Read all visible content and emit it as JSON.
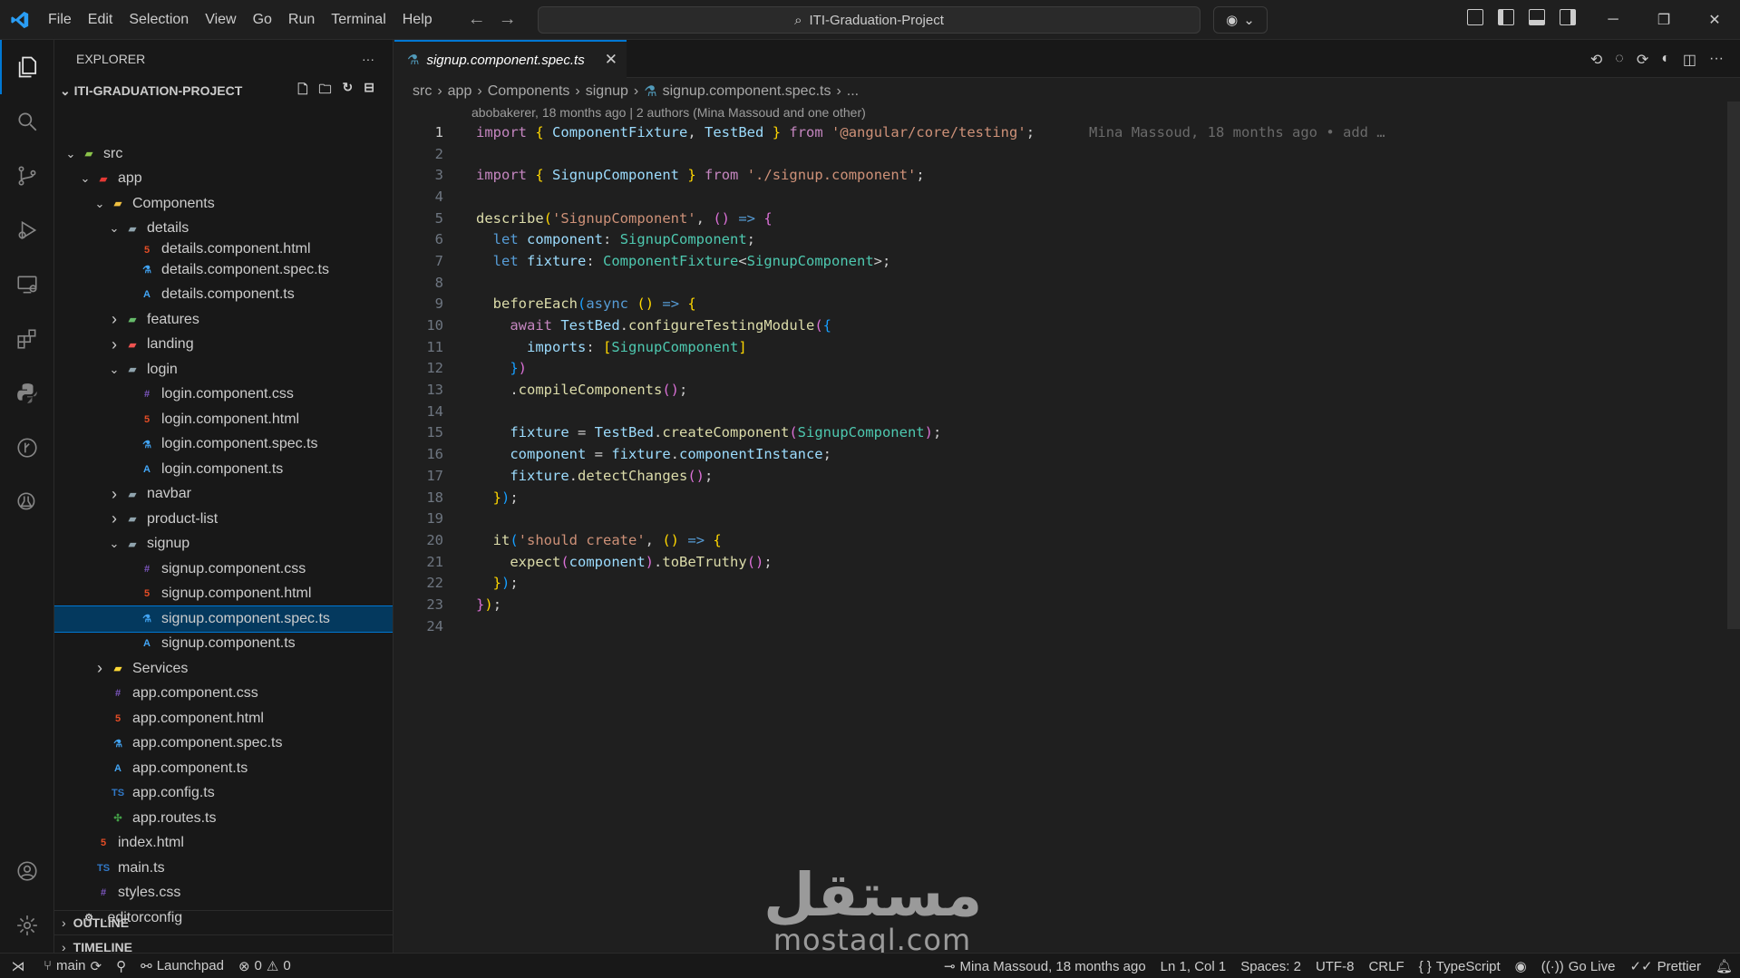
{
  "menu": [
    "File",
    "Edit",
    "Selection",
    "View",
    "Go",
    "Run",
    "Terminal",
    "Help"
  ],
  "command_center": "ITI-Graduation-Project",
  "sidebar": {
    "title": "EXPLORER",
    "project": "ITI-GRADUATION-PROJECT",
    "tree": [
      {
        "label": "src",
        "depth": 1,
        "kind": "folder-open",
        "icon": "src-folder-icon"
      },
      {
        "label": "app",
        "depth": 2,
        "kind": "folder-open",
        "icon": "app-folder-icon"
      },
      {
        "label": "Components",
        "depth": 3,
        "kind": "folder-open",
        "icon": "components-folder-icon"
      },
      {
        "label": "details",
        "depth": 4,
        "kind": "folder-open",
        "icon": "folder-icon"
      },
      {
        "label": "details.component.html",
        "depth": 5,
        "kind": "file",
        "icon": "html-icon"
      },
      {
        "label": "details.component.spec.ts",
        "depth": 5,
        "kind": "file",
        "icon": "test-icon"
      },
      {
        "label": "details.component.ts",
        "depth": 5,
        "kind": "file",
        "icon": "angular-icon"
      },
      {
        "label": "features",
        "depth": 4,
        "kind": "folder",
        "icon": "features-folder-icon"
      },
      {
        "label": "landing",
        "depth": 4,
        "kind": "folder",
        "icon": "landing-folder-icon"
      },
      {
        "label": "login",
        "depth": 4,
        "kind": "folder-open",
        "icon": "folder-icon"
      },
      {
        "label": "login.component.css",
        "depth": 5,
        "kind": "file",
        "icon": "css-icon"
      },
      {
        "label": "login.component.html",
        "depth": 5,
        "kind": "file",
        "icon": "html-icon"
      },
      {
        "label": "login.component.spec.ts",
        "depth": 5,
        "kind": "file",
        "icon": "test-icon"
      },
      {
        "label": "login.component.ts",
        "depth": 5,
        "kind": "file",
        "icon": "angular-icon"
      },
      {
        "label": "navbar",
        "depth": 4,
        "kind": "folder",
        "icon": "folder-icon"
      },
      {
        "label": "product-list",
        "depth": 4,
        "kind": "folder",
        "icon": "folder-icon"
      },
      {
        "label": "signup",
        "depth": 4,
        "kind": "folder-open",
        "icon": "folder-icon"
      },
      {
        "label": "signup.component.css",
        "depth": 5,
        "kind": "file",
        "icon": "css-icon"
      },
      {
        "label": "signup.component.html",
        "depth": 5,
        "kind": "file",
        "icon": "html-icon"
      },
      {
        "label": "signup.component.spec.ts",
        "depth": 5,
        "kind": "file",
        "icon": "test-icon",
        "selected": true
      },
      {
        "label": "signup.component.ts",
        "depth": 5,
        "kind": "file",
        "icon": "angular-icon"
      },
      {
        "label": "Services",
        "depth": 3,
        "kind": "folder",
        "icon": "services-folder-icon"
      },
      {
        "label": "app.component.css",
        "depth": 3,
        "kind": "file",
        "icon": "css-icon"
      },
      {
        "label": "app.component.html",
        "depth": 3,
        "kind": "file",
        "icon": "html-icon"
      },
      {
        "label": "app.component.spec.ts",
        "depth": 3,
        "kind": "file",
        "icon": "test-icon"
      },
      {
        "label": "app.component.ts",
        "depth": 3,
        "kind": "file",
        "icon": "angular-icon"
      },
      {
        "label": "app.config.ts",
        "depth": 3,
        "kind": "file",
        "icon": "ts-icon"
      },
      {
        "label": "app.routes.ts",
        "depth": 3,
        "kind": "file",
        "icon": "routes-icon"
      },
      {
        "label": "index.html",
        "depth": 2,
        "kind": "file",
        "icon": "html-icon"
      },
      {
        "label": "main.ts",
        "depth": 2,
        "kind": "file",
        "icon": "ts-icon"
      },
      {
        "label": "styles.css",
        "depth": 2,
        "kind": "file",
        "icon": "css-icon"
      },
      {
        "label": ".editorconfig",
        "depth": 1,
        "kind": "file",
        "icon": "editorconfig-icon"
      }
    ],
    "outline": "OUTLINE",
    "timeline": "TIMELINE"
  },
  "tab": {
    "label": "signup.component.spec.ts"
  },
  "breadcrumb": [
    "src",
    "app",
    "Components",
    "signup",
    "signup.component.spec.ts",
    "..."
  ],
  "blame_header": "abobakerer, 18 months ago | 2 authors (Mina Massoud and one other)",
  "inline_blame": "Mina Massoud, 18 months ago • add …",
  "code_lines": 24,
  "watermark": {
    "arabic": "مستقل",
    "latin": "mostaql.com"
  },
  "status": {
    "branch": "main",
    "launchpad": "Launchpad",
    "errors": "0",
    "warnings": "0",
    "blame": "Mina Massoud, 18 months ago",
    "position": "Ln 1, Col 1",
    "spaces": "Spaces: 2",
    "encoding": "UTF-8",
    "eol": "CRLF",
    "language": "TypeScript",
    "golive": "Go Live",
    "prettier": "Prettier"
  }
}
